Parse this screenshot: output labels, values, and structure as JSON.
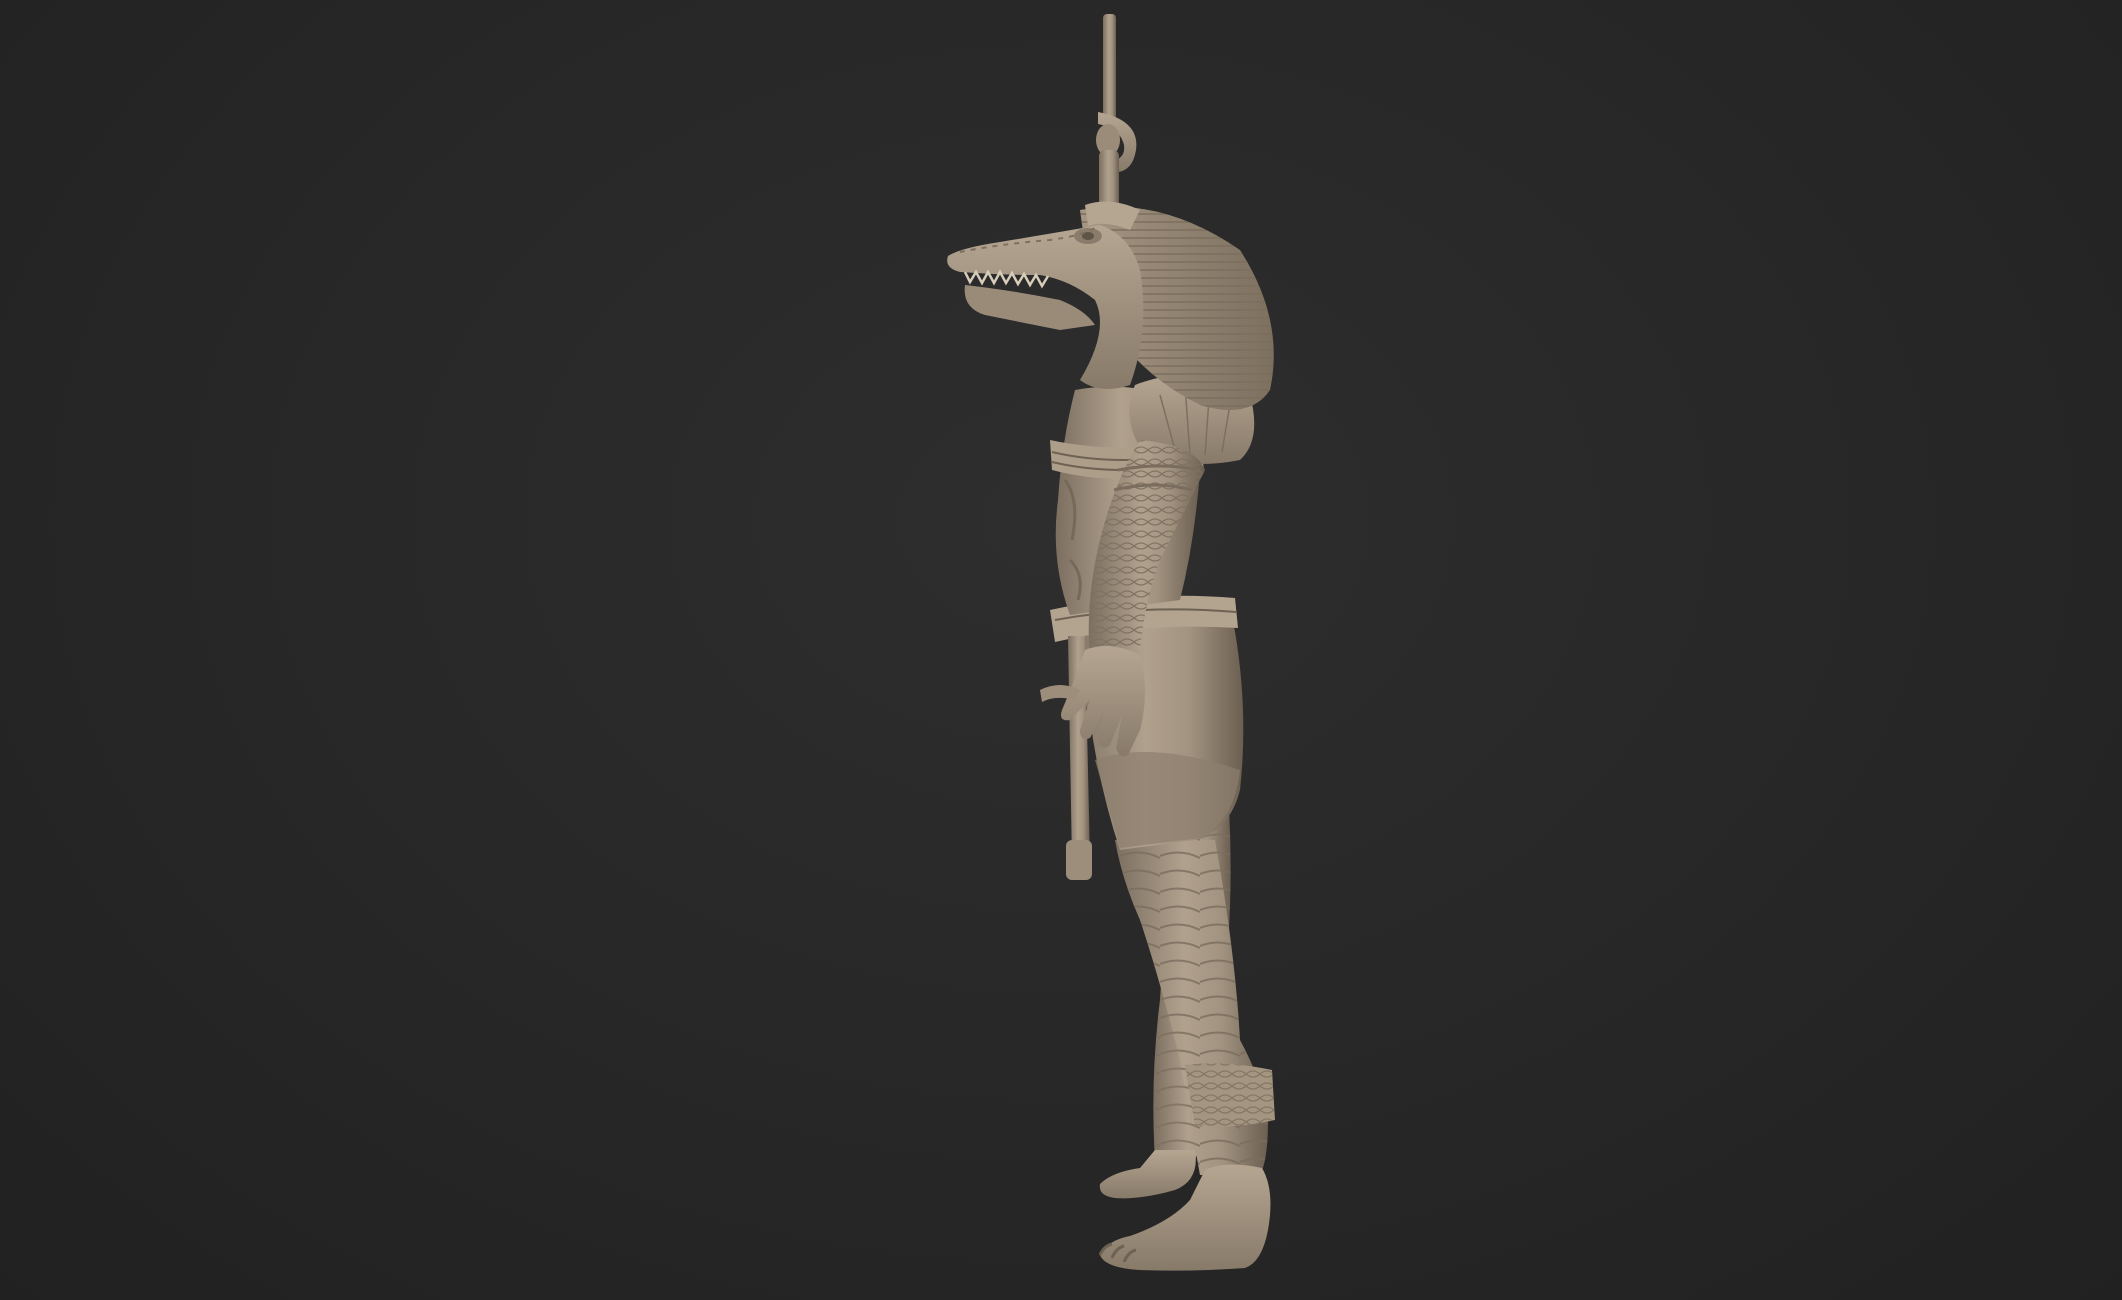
{
  "scene": {
    "background_color": "#262626",
    "model_base_color": "#a99a87",
    "model_shadow_color": "#6e6253",
    "model_highlight_color": "#cbbfae",
    "subject": "crocodile-headed-deity-sculpt",
    "view": "side-profile"
  }
}
